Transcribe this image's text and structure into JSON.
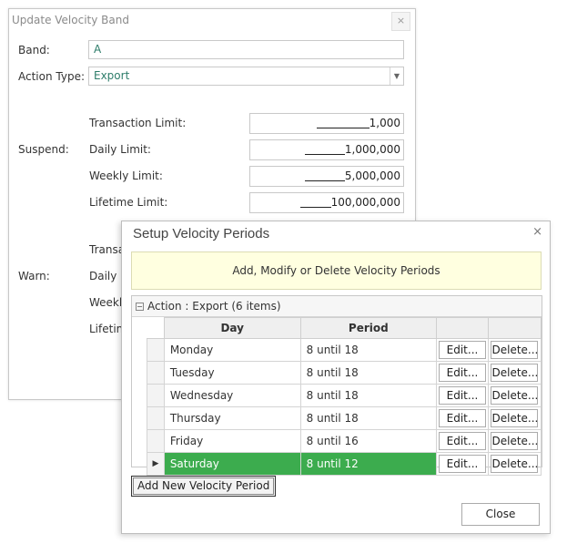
{
  "update_dialog": {
    "title": "Update Velocity Band",
    "close_glyph": "×",
    "band_label": "Band:",
    "band_value": "A",
    "action_type_label": "Action Type:",
    "action_type_value": "Export",
    "suspend_label": "Suspend:",
    "warn_label": "Warn:",
    "suspend_limits": [
      {
        "label": "Transaction Limit:",
        "value": "1,000"
      },
      {
        "label": "Daily Limit:",
        "value": "1,000,000"
      },
      {
        "label": "Weekly Limit:",
        "value": "5,000,000"
      },
      {
        "label": "Lifetime Limit:",
        "value": "100,000,000"
      }
    ],
    "warn_limits_visible": [
      "Transa",
      "Daily L",
      "Weekly",
      "Lifetim"
    ]
  },
  "setup_dialog": {
    "title": "Setup Velocity Periods",
    "close_glyph": "×",
    "banner": "Add, Modify or Delete Velocity Periods",
    "group_toggle": "−",
    "group_label": "Action : Export (6 items)",
    "columns": [
      "Day",
      "Period"
    ],
    "rows": [
      {
        "day": "Monday",
        "period": "8 until 18"
      },
      {
        "day": "Tuesday",
        "period": "8 until 18"
      },
      {
        "day": "Wednesday",
        "period": "8 until 18"
      },
      {
        "day": "Thursday",
        "period": "8 until 18"
      },
      {
        "day": "Friday",
        "period": "8 until 16"
      },
      {
        "day": "Saturday",
        "period": "8 until 12"
      }
    ],
    "selected_row": 5,
    "row_pointer": "▶",
    "edit_label": "Edit...",
    "delete_label": "Delete...",
    "add_button": "Add New Velocity Period",
    "close_button": "Close",
    "selection_color": "#3cac4e"
  }
}
